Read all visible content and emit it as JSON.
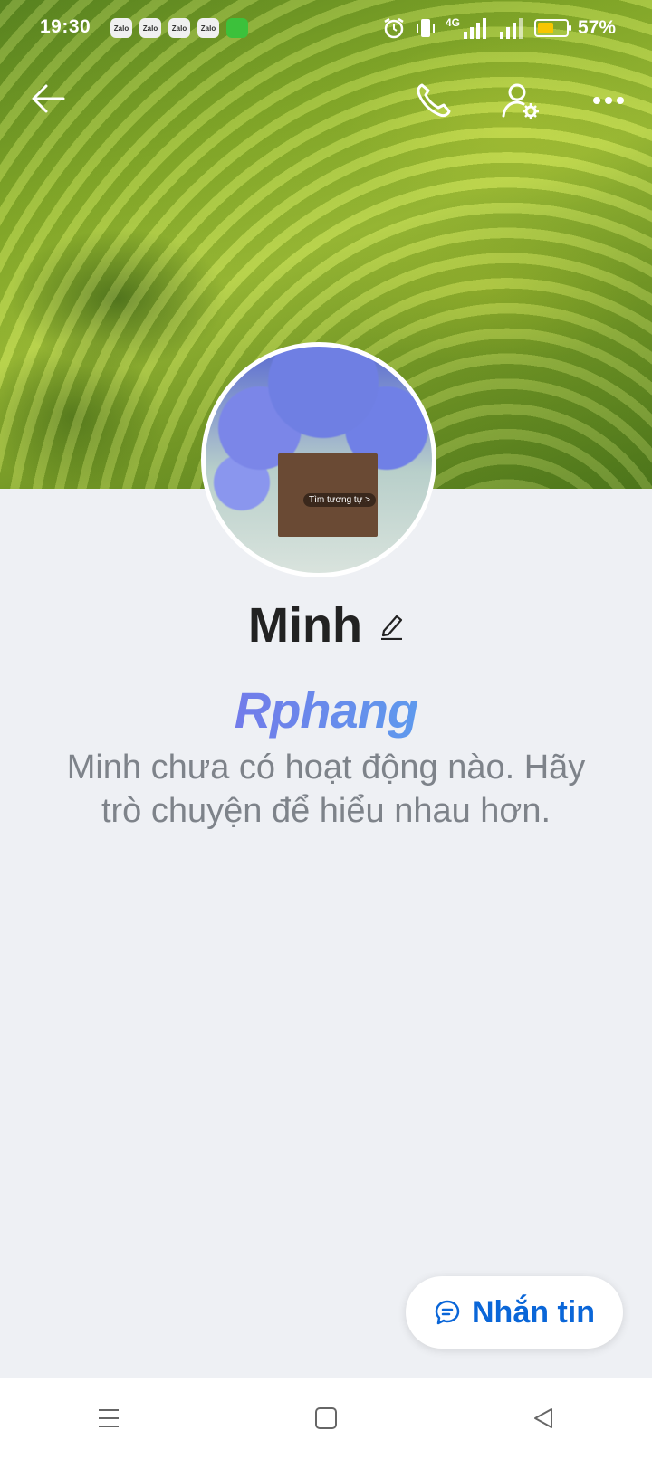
{
  "status_bar": {
    "time": "19:30",
    "notif_app": "Zalo",
    "network": "4G",
    "battery": "57%",
    "battery_level": 0.57
  },
  "profile": {
    "name": "Minh",
    "avatar_overlay_text": "Tìm tương tự >",
    "watermark": "Rphang",
    "empty_message": "Minh chưa có hoạt động nào. Hãy trò chuyện để hiểu nhau hơn."
  },
  "actions": {
    "message_label": "Nhắn tin"
  },
  "icons": {
    "back": "arrow-left-icon",
    "call": "phone-icon",
    "profile_settings": "user-gear-icon",
    "more": "more-horizontal-icon",
    "edit": "pencil-icon",
    "chat": "chat-bubble-icon"
  },
  "colors": {
    "accent": "#0a66d8",
    "background": "#eef0f4",
    "battery": "#f7c600"
  }
}
